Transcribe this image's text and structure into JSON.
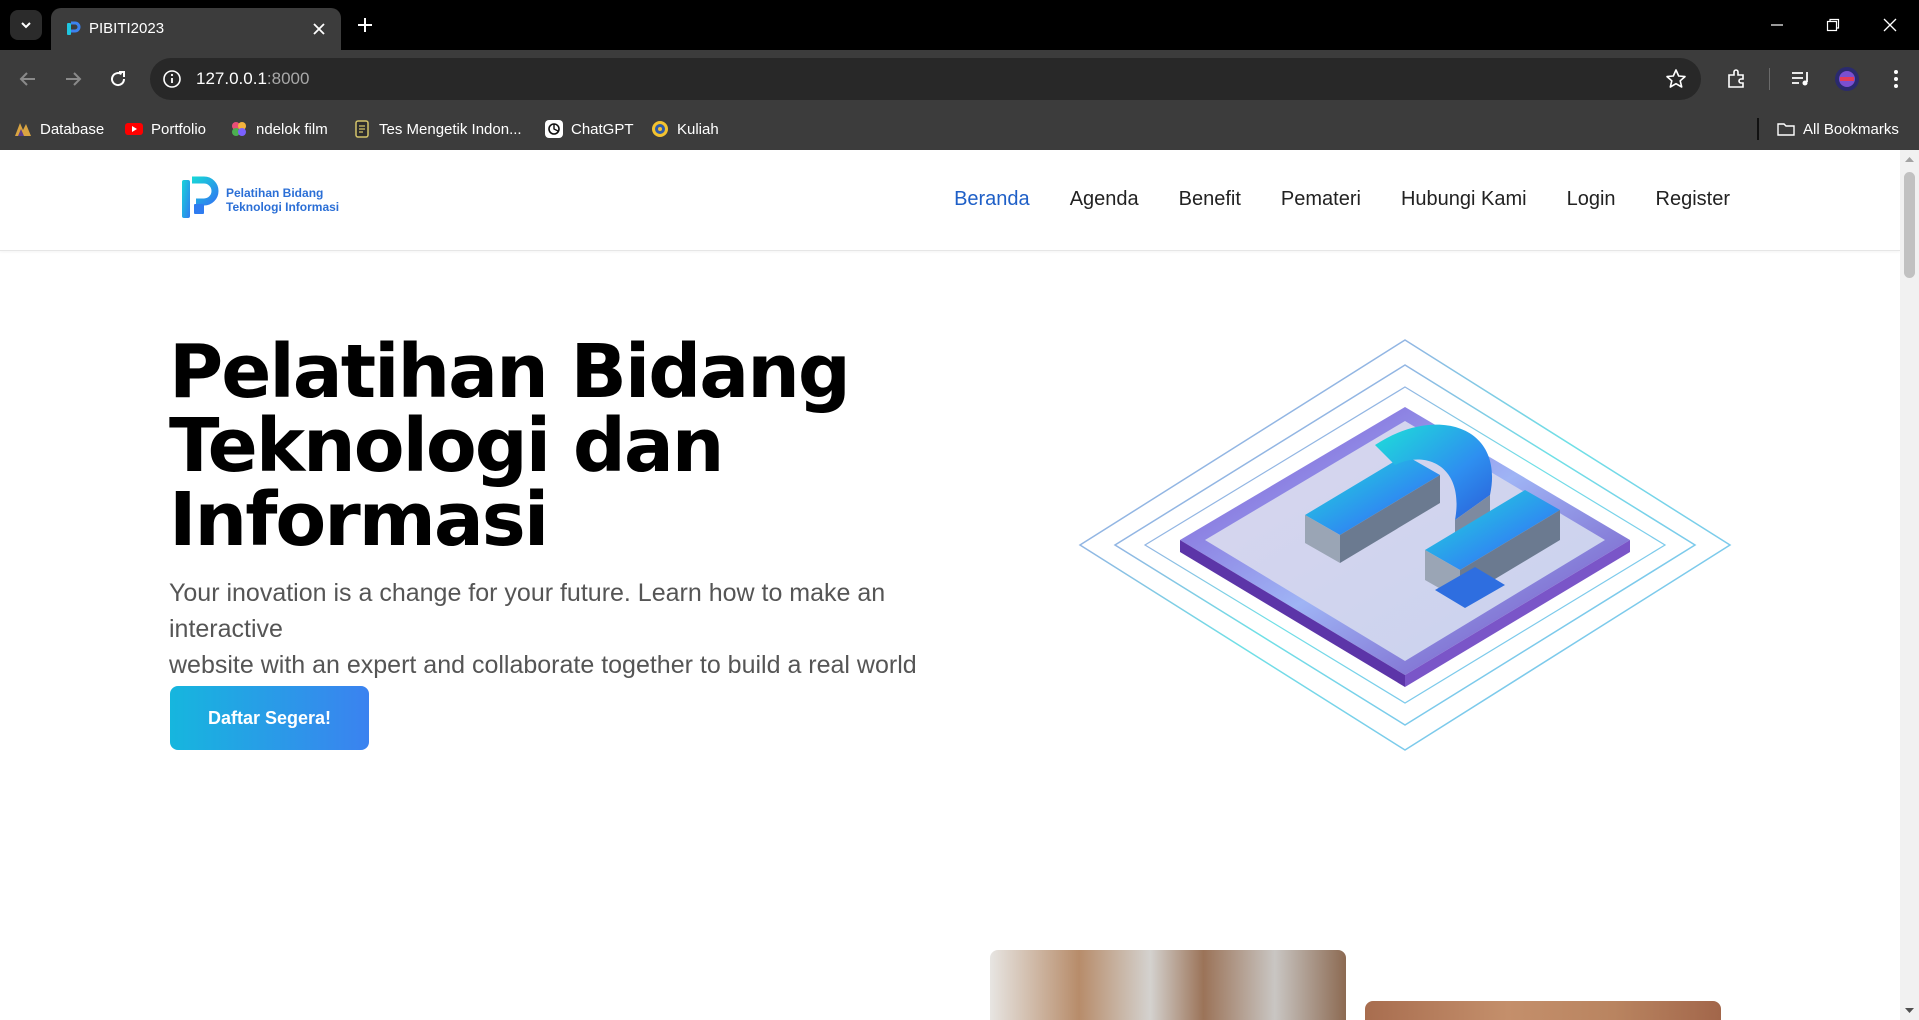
{
  "browser": {
    "tab": {
      "title": "PIBITI2023",
      "favicon": "pibiti-logo-icon"
    },
    "address": {
      "host": "127.0.0.1",
      "port": ":8000"
    },
    "bookmarks": [
      {
        "label": "Database",
        "icon": "database-icon"
      },
      {
        "label": "Portfolio",
        "icon": "youtube-icon"
      },
      {
        "label": "ndelok film",
        "icon": "film-icon"
      },
      {
        "label": "Tes Mengetik Indon...",
        "icon": "typing-test-icon"
      },
      {
        "label": "ChatGPT",
        "icon": "chatgpt-icon"
      },
      {
        "label": "Kuliah",
        "icon": "university-icon"
      }
    ],
    "all_bookmarks_label": "All Bookmarks"
  },
  "site": {
    "logo": {
      "line1": "Pelatihan Bidang",
      "line2": "Teknologi Informasi"
    },
    "nav": [
      {
        "label": "Beranda",
        "active": true
      },
      {
        "label": "Agenda",
        "active": false
      },
      {
        "label": "Benefit",
        "active": false
      },
      {
        "label": "Pemateri",
        "active": false
      },
      {
        "label": "Hubungi Kami",
        "active": false
      },
      {
        "label": "Login",
        "active": false
      },
      {
        "label": "Register",
        "active": false
      }
    ],
    "hero": {
      "title_lines": [
        "Pelatihan Bidang",
        "Teknologi dan",
        "Informasi"
      ],
      "subtitle_lines": [
        "Your inovation is a change for your future. Learn how to make an interactive",
        "website with an expert and collaborate together to build a real world project!"
      ],
      "cta": "Daftar Segera!"
    }
  },
  "colors": {
    "nav_active": "#1e5fc7",
    "cta_start": "#16b6de",
    "cta_end": "#3b82f0",
    "browser_frame": "#3c3c3c"
  }
}
